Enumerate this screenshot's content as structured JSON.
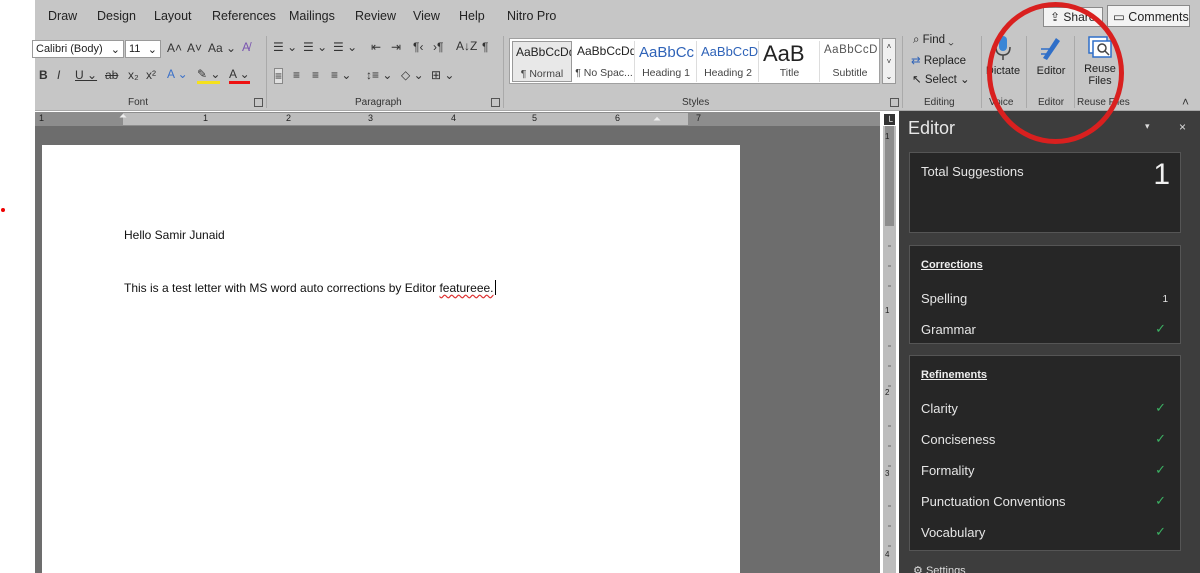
{
  "menu": {
    "tabs": [
      "Draw",
      "Design",
      "Layout",
      "References",
      "Mailings",
      "Review",
      "View",
      "Help",
      "Nitro Pro"
    ],
    "share_label": "Share",
    "comments_label": "Comments"
  },
  "ribbon": {
    "font": {
      "font_name": "Calibri (Body)",
      "font_size": "11",
      "change_case": "Aa",
      "group_label": "Font"
    },
    "paragraph": {
      "group_label": "Paragraph"
    },
    "styles": {
      "items": [
        {
          "preview": "AaBbCcDd",
          "name": "¶ Normal"
        },
        {
          "preview": "AaBbCcDd",
          "name": "¶ No Spac..."
        },
        {
          "preview": "AaBbCc",
          "name": "Heading 1"
        },
        {
          "preview": "AaBbCcD",
          "name": "Heading 2"
        },
        {
          "preview": "AaB",
          "name": "Title"
        },
        {
          "preview": "AaBbCcD",
          "name": "Subtitle"
        }
      ],
      "group_label": "Styles"
    },
    "editing": {
      "find": "Find",
      "replace": "Replace",
      "select": "Select",
      "group_label": "Editing"
    },
    "voice": {
      "dictate": "Dictate",
      "group_label": "Voice"
    },
    "editor": {
      "editor": "Editor",
      "group_label": "Editor"
    },
    "reuse": {
      "reuse_line1": "Reuse",
      "reuse_line2": "Files",
      "group_label": "Reuse Files"
    }
  },
  "ruler": {
    "numbers": [
      "1",
      "1",
      "2",
      "3",
      "4",
      "5",
      "6",
      "7"
    ]
  },
  "document": {
    "line1": "Hello Samir Junaid",
    "line2_prefix": "This is a test letter with MS word auto corrections by Editor ",
    "line2_misspelled": "featureee."
  },
  "vruler": {
    "numbers": [
      "1",
      "1",
      "2",
      "3",
      "4"
    ]
  },
  "editor_pane": {
    "title": "Editor",
    "total_label": "Total Suggestions",
    "total_count": "1",
    "corrections": {
      "title": "Corrections",
      "spelling": "Spelling",
      "spelling_count": "1",
      "grammar": "Grammar"
    },
    "refinements": {
      "title": "Refinements",
      "items": [
        "Clarity",
        "Conciseness",
        "Formality",
        "Punctuation Conventions",
        "Vocabulary"
      ]
    },
    "settings": "Settings"
  },
  "colors": {
    "check_green": "#3bb062",
    "annotation_red": "#d9201f"
  }
}
